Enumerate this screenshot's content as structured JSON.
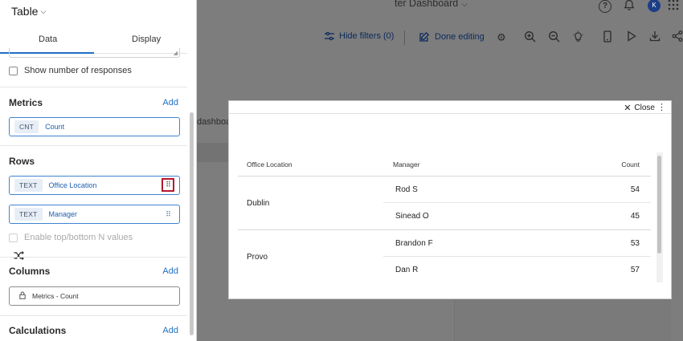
{
  "background": {
    "dashboard_title": "ter Dashboard",
    "avatar_initial": "K",
    "hide_filters_label": "Hide filters (0)",
    "done_editing_label": "Done editing",
    "dashboard_fragment": "dashboar"
  },
  "panel": {
    "title": "Table",
    "tabs": [
      {
        "label": "Data",
        "active": true
      },
      {
        "label": "Display",
        "active": false
      }
    ],
    "show_responses_label": "Show number of responses",
    "metrics": {
      "title": "Metrics",
      "add_label": "Add",
      "items": [
        {
          "type": "CNT",
          "label": "Count"
        }
      ]
    },
    "rows": {
      "title": "Rows",
      "items": [
        {
          "type": "TEXT",
          "label": "Office Location"
        },
        {
          "type": "TEXT",
          "label": "Manager"
        }
      ],
      "top_bottom_label": "Enable top/bottom N values"
    },
    "columns": {
      "title": "Columns",
      "add_label": "Add",
      "locked_item": "Metrics - Count"
    },
    "calculations": {
      "title": "Calculations",
      "add_label": "Add"
    }
  },
  "modal": {
    "close_label": "Close",
    "table": {
      "headers": [
        "Office Location",
        "Manager",
        "Count"
      ],
      "groups": [
        {
          "location": "Dublin",
          "rows": [
            {
              "manager": "Rod S",
              "count": "54"
            },
            {
              "manager": "Sinead O",
              "count": "45"
            }
          ]
        },
        {
          "location": "Provo",
          "rows": [
            {
              "manager": "Brandon F",
              "count": "53"
            },
            {
              "manager": "Dan R",
              "count": "57"
            }
          ]
        }
      ]
    }
  },
  "colors": {
    "accent": "#1f6fc5",
    "highlight": "#b5192e",
    "avatar": "#1d3e86"
  }
}
